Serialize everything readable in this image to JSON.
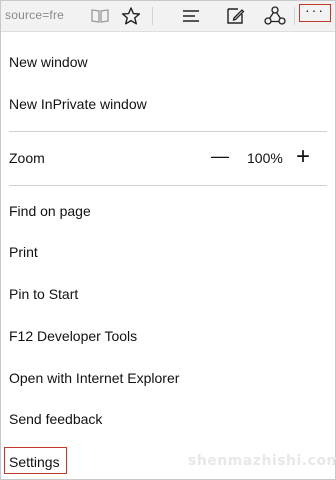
{
  "toolbar": {
    "url_fragment": "source=fre",
    "icons": [
      "reading-view-icon",
      "favorite-star-icon",
      "hub-icon",
      "web-note-icon",
      "share-icon",
      "more-actions-icon"
    ],
    "more_label": "···"
  },
  "menu": {
    "new_window": "New window",
    "new_inprivate_window": "New InPrivate window",
    "zoom_label": "Zoom",
    "zoom_minus": "—",
    "zoom_value": "100%",
    "zoom_plus": "+",
    "find_on_page": "Find on page",
    "print": "Print",
    "pin_to_start": "Pin to Start",
    "f12_tools": "F12 Developer Tools",
    "open_with_ie": "Open with Internet Explorer",
    "send_feedback": "Send feedback",
    "settings": "Settings"
  },
  "highlight_color": "#c0392b",
  "watermark": "shenmazhishi.com"
}
